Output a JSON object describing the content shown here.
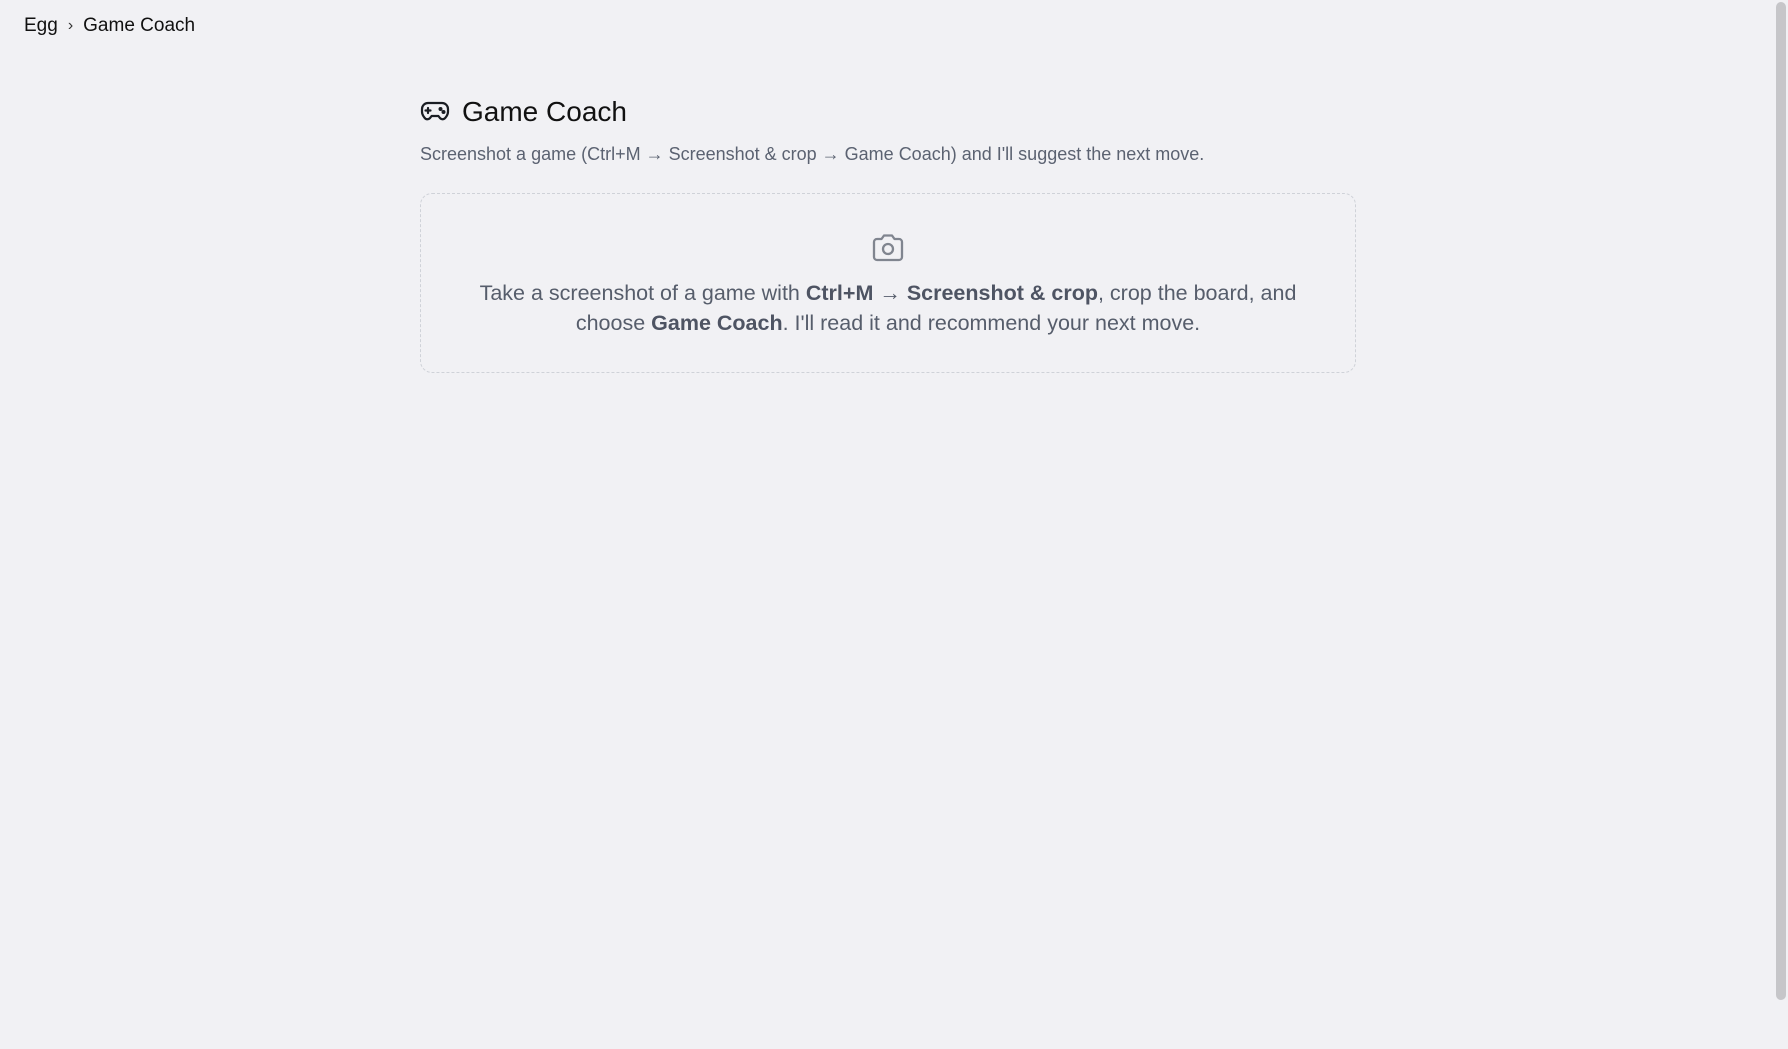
{
  "breadcrumb": {
    "root": "Egg",
    "separator": "›",
    "current": "Game Coach"
  },
  "header": {
    "icon": "gamepad-icon",
    "title": "Game Coach",
    "subtitle": "Screenshot a game (Ctrl+M → Screenshot & crop → Game Coach) and I'll suggest the next move."
  },
  "dropzone": {
    "icon": "camera-icon",
    "text_1": "Take a screenshot of a game with ",
    "bold_1": "Ctrl+M",
    "text_2": " → ",
    "bold_2": "Screenshot & crop",
    "text_3": ", crop the board, and choose ",
    "bold_3": "Game Coach",
    "text_4": ". I'll read it and recommend your next move."
  },
  "colors": {
    "background": "#f1f1f4",
    "text_primary": "#111111",
    "text_secondary": "#5b6271",
    "border_dashed": "#cfd2d8",
    "icon_gray": "#80858f"
  }
}
